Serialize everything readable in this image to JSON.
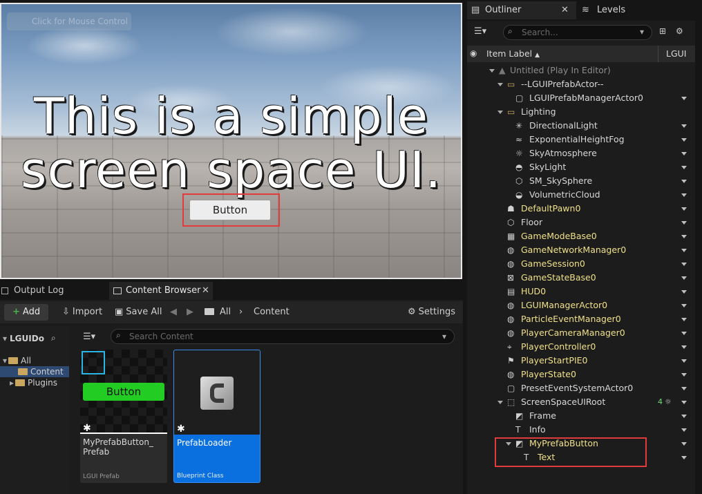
{
  "viewport": {
    "mouse_hint": "Click for Mouse Control",
    "line1": "This is a simple",
    "line2": "screen space UI.",
    "button_label": "Button"
  },
  "bottom": {
    "tabs": [
      "Output Log",
      "Content Browser"
    ],
    "toolbar": {
      "add": "Add",
      "import": "Import",
      "save_all": "Save All",
      "path_all": "All",
      "path_content": "Content",
      "settings": "Settings"
    },
    "sidebar": {
      "root": "LGUIDo",
      "items": [
        "All",
        "Content",
        "Plugins"
      ]
    },
    "search_placeholder": "Search Content",
    "assets": [
      {
        "thumb_label": "Button",
        "name": "MyPrefabButton_\nPrefab",
        "type": "LGUI Prefab"
      },
      {
        "name": "PrefabLoader",
        "type": "Blueprint Class"
      }
    ]
  },
  "outliner": {
    "tabs": [
      "Outliner",
      "Levels"
    ],
    "search_placeholder": "Search...",
    "header": {
      "item_label": "Item Label",
      "type_col": "LGUI"
    },
    "rows": [
      {
        "label": "Untitled (Play In Editor)",
        "indent": 0,
        "color": "gray",
        "expand": "down",
        "dd": false
      },
      {
        "label": "--LGUIPrefabActor--",
        "indent": 1,
        "color": "white",
        "expand": "down",
        "icon": "folder",
        "dd": false
      },
      {
        "label": "LGUIPrefabManagerActor0",
        "indent": 2,
        "color": "white",
        "icon": "actor",
        "dd": true
      },
      {
        "label": "Lighting",
        "indent": 1,
        "color": "white",
        "expand": "down",
        "icon": "folder",
        "dd": false
      },
      {
        "label": "DirectionalLight",
        "indent": 2,
        "color": "white",
        "icon": "sun",
        "dd": true
      },
      {
        "label": "ExponentialHeightFog",
        "indent": 2,
        "color": "white",
        "icon": "fog",
        "dd": true
      },
      {
        "label": "SkyAtmosphere",
        "indent": 2,
        "color": "white",
        "icon": "sky",
        "dd": true
      },
      {
        "label": "SkyLight",
        "indent": 2,
        "color": "white",
        "icon": "skylight",
        "dd": true
      },
      {
        "label": "SM_SkySphere",
        "indent": 2,
        "color": "white",
        "icon": "mesh",
        "dd": true
      },
      {
        "label": "VolumetricCloud",
        "indent": 2,
        "color": "white",
        "icon": "cloud",
        "dd": true
      },
      {
        "label": "DefaultPawn0",
        "indent": 1,
        "color": "yellow",
        "icon": "pawn",
        "dd": true
      },
      {
        "label": "Floor",
        "indent": 1,
        "color": "white",
        "icon": "mesh",
        "dd": true
      },
      {
        "label": "GameModeBase0",
        "indent": 1,
        "color": "yellow",
        "icon": "gamemode",
        "dd": true
      },
      {
        "label": "GameNetworkManager0",
        "indent": 1,
        "color": "yellow",
        "icon": "info",
        "dd": true
      },
      {
        "label": "GameSession0",
        "indent": 1,
        "color": "yellow",
        "icon": "info",
        "dd": true
      },
      {
        "label": "GameStateBase0",
        "indent": 1,
        "color": "yellow",
        "icon": "state",
        "dd": true
      },
      {
        "label": "HUD0",
        "indent": 1,
        "color": "yellow",
        "icon": "hud",
        "dd": true
      },
      {
        "label": "LGUIManagerActor0",
        "indent": 1,
        "color": "yellow",
        "icon": "info",
        "dd": true
      },
      {
        "label": "ParticleEventManager0",
        "indent": 1,
        "color": "yellow",
        "icon": "info",
        "dd": true
      },
      {
        "label": "PlayerCameraManager0",
        "indent": 1,
        "color": "yellow",
        "icon": "info",
        "dd": true
      },
      {
        "label": "PlayerController0",
        "indent": 1,
        "color": "yellow",
        "icon": "controller",
        "dd": true
      },
      {
        "label": "PlayerStartPIE0",
        "indent": 1,
        "color": "yellow",
        "icon": "flag",
        "dd": true
      },
      {
        "label": "PlayerState0",
        "indent": 1,
        "color": "yellow",
        "icon": "info",
        "dd": true
      },
      {
        "label": "PresetEventSystemActor0",
        "indent": 1,
        "color": "white",
        "icon": "actor",
        "dd": true
      },
      {
        "label": "ScreenSpaceUIRoot",
        "indent": 1,
        "color": "white",
        "expand": "down",
        "icon": "uiroot",
        "badge": "4",
        "dd": true
      },
      {
        "label": "Frame",
        "indent": 2,
        "color": "white",
        "icon": "image",
        "dd": true
      },
      {
        "label": "Info",
        "indent": 2,
        "color": "white",
        "icon": "text",
        "dd": true
      },
      {
        "label": "MyPrefabButton",
        "indent": 2,
        "color": "yellow",
        "expand": "down",
        "icon": "image",
        "dd": true
      },
      {
        "label": "Text",
        "indent": 3,
        "color": "yellow",
        "icon": "text",
        "dd": true
      }
    ]
  },
  "colors": {
    "accent_blue": "#0a70e0",
    "green_button": "#22cc22",
    "highlight_red": "#e23b3b",
    "yellow_label": "#efe08a"
  }
}
